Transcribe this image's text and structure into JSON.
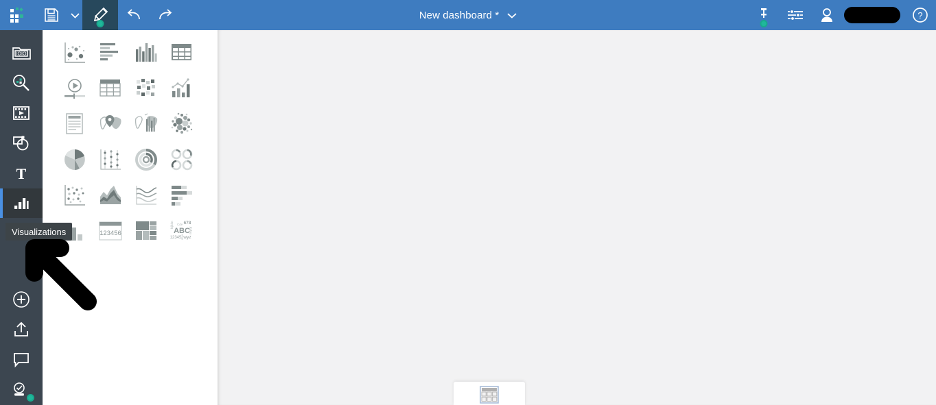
{
  "topbar": {
    "bg_color": "#3e7cc0",
    "active_tool_bg": "#27485c",
    "title": "New dashboard *",
    "buttons": [
      {
        "name": "app-logo",
        "label": "Tableau logo",
        "icon": "logo-icon"
      },
      {
        "name": "save-button",
        "label": "Save",
        "icon": "save-icon"
      },
      {
        "name": "save-dropdown",
        "label": "Save options",
        "icon": "chevron-down-icon"
      },
      {
        "name": "edit-button",
        "label": "Edit",
        "icon": "pencil-icon",
        "active": true,
        "status_dot": "#1fb89b"
      },
      {
        "name": "undo-button",
        "label": "Undo",
        "icon": "undo-icon"
      },
      {
        "name": "redo-button",
        "label": "Redo",
        "icon": "redo-icon"
      }
    ],
    "right_buttons": [
      {
        "name": "pin-button",
        "label": "Pin",
        "icon": "pin-icon",
        "status_dot": "#1fb89b"
      },
      {
        "name": "settings-button",
        "label": "Settings",
        "icon": "sliders-icon"
      },
      {
        "name": "account-button",
        "label": "Account",
        "icon": "user-icon"
      },
      {
        "name": "username-redacted",
        "label": "",
        "icon": "redaction-bar"
      },
      {
        "name": "help-button",
        "label": "Help",
        "icon": "question-circle-icon"
      }
    ]
  },
  "sidebar": {
    "bg_color": "#3c4650",
    "active_color": "#4a90e2",
    "items": [
      {
        "label": "Data",
        "icon": "data-source-icon",
        "active": false
      },
      {
        "label": "Analytics",
        "icon": "search-data-icon",
        "active": false
      },
      {
        "label": "Media",
        "icon": "film-icon",
        "active": false
      },
      {
        "label": "Shapes",
        "icon": "shapes-icon",
        "active": false
      },
      {
        "label": "Text",
        "icon": "text-icon",
        "active": false
      },
      {
        "label": "Visualizations",
        "icon": "bar-chart-icon",
        "active": true
      }
    ],
    "bottom_items": [
      {
        "label": "Add",
        "icon": "plus-circle-icon"
      },
      {
        "label": "Export",
        "icon": "upload-icon"
      },
      {
        "label": "Comments",
        "icon": "comment-icon"
      },
      {
        "label": "Approved",
        "icon": "verified-user-icon",
        "status_dot": "#1fb89b"
      }
    ]
  },
  "tooltip": {
    "text": "Visualizations"
  },
  "palette": {
    "visualizations": [
      {
        "label": "Bubble scatter",
        "icon": "bubble-scatter-icon"
      },
      {
        "label": "Horizontal bar",
        "icon": "horizontal-bar-icon"
      },
      {
        "label": "Column chart",
        "icon": "column-chart-icon"
      },
      {
        "label": "Table",
        "icon": "table-icon"
      },
      {
        "label": "Animation",
        "icon": "play-timeline-icon"
      },
      {
        "label": "Pivot table",
        "icon": "pivot-table-icon"
      },
      {
        "label": "Heatmap",
        "icon": "heatmap-icon"
      },
      {
        "label": "Combo chart",
        "icon": "combo-chart-icon"
      },
      {
        "label": "Text document",
        "icon": "document-icon"
      },
      {
        "label": "Map",
        "icon": "map-pin-icon"
      },
      {
        "label": "3D map",
        "icon": "map-3d-bars-icon"
      },
      {
        "label": "Packed bubbles",
        "icon": "packed-bubbles-icon"
      },
      {
        "label": "Pie chart",
        "icon": "pie-chart-icon"
      },
      {
        "label": "Dot plot",
        "icon": "dot-plot-icon"
      },
      {
        "label": "Radial chart",
        "icon": "radial-chart-icon"
      },
      {
        "label": "Gauges",
        "icon": "gauges-icon"
      },
      {
        "label": "Scatter plot",
        "icon": "scatter-plot-icon"
      },
      {
        "label": "Area chart",
        "icon": "area-chart-icon"
      },
      {
        "label": "Line chart",
        "icon": "line-chart-icon"
      },
      {
        "label": "Bullet chart",
        "icon": "bullet-chart-icon"
      },
      {
        "label": "Stacked bars",
        "icon": "stacked-bars-icon"
      },
      {
        "label": "Number",
        "icon": "number-kpi-icon",
        "sample_value": "123456"
      },
      {
        "label": "Treemap",
        "icon": "treemap-icon"
      },
      {
        "label": "Word cloud",
        "icon": "word-cloud-icon",
        "sample_words": [
          "ABC",
          "678",
          "12345",
          "wyz"
        ]
      }
    ]
  },
  "canvas": {
    "bg_color": "#f2f2f3",
    "drop_card": {
      "label": "Table placeholder",
      "icon": "table-grid-icon"
    }
  },
  "annotation": {
    "arrow": {
      "label": "pointer-arrow",
      "color": "#000000",
      "direction": "up-left"
    }
  }
}
